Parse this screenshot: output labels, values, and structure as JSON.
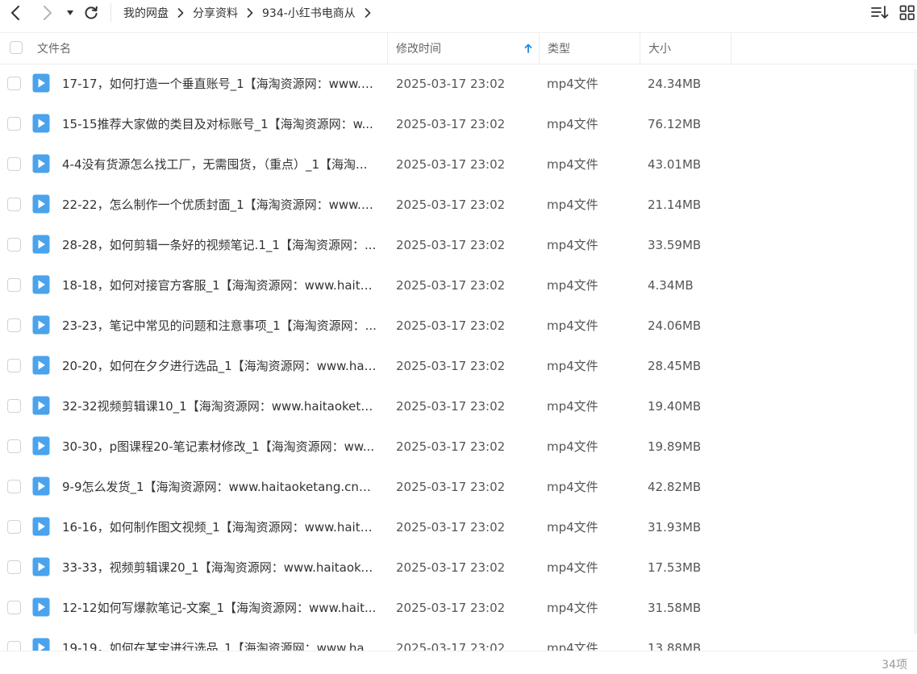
{
  "toolbar": {
    "back_icon": "chevron-left-icon",
    "forward_icon": "chevron-right-icon",
    "history_icon": "caret-down-icon",
    "refresh_icon": "refresh-icon",
    "sort_icon": "sort-list-icon",
    "view_icon": "grid-view-icon"
  },
  "breadcrumb": [
    "我的网盘",
    "分享资料",
    "934-小红书电商从"
  ],
  "columns": {
    "name": "文件名",
    "modified": "修改时间",
    "type": "类型",
    "size": "大小"
  },
  "sort": {
    "column": "modified",
    "direction": "ascending",
    "icon": "arrow-up-icon",
    "color": "#1e88e5"
  },
  "colors": {
    "video_icon": "#4aa3ec",
    "accent": "#1e88e5"
  },
  "files": [
    {
      "name": "17-17，如何打造一个垂直账号_1【海淘资源网：www.h...",
      "modified": "2025-03-17 23:02",
      "type": "mp4文件",
      "size": "24.34MB",
      "icon": "video-file-icon"
    },
    {
      "name": "15-15推荐大家做的类目及对标账号_1【海淘资源网：w...",
      "modified": "2025-03-17 23:02",
      "type": "mp4文件",
      "size": "76.12MB",
      "icon": "video-file-icon"
    },
    {
      "name": "4-4没有货源怎么找工厂，无需囤货，（重点）_1【海淘...",
      "modified": "2025-03-17 23:02",
      "type": "mp4文件",
      "size": "43.01MB",
      "icon": "video-file-icon"
    },
    {
      "name": "22-22，怎么制作一个优质封面_1【海淘资源网：www.h...",
      "modified": "2025-03-17 23:02",
      "type": "mp4文件",
      "size": "21.14MB",
      "icon": "video-file-icon"
    },
    {
      "name": "28-28，如何剪辑一条好的视频笔记.1_1【海淘资源网：...",
      "modified": "2025-03-17 23:02",
      "type": "mp4文件",
      "size": "33.59MB",
      "icon": "video-file-icon"
    },
    {
      "name": "18-18，如何对接官方客服_1【海淘资源网：www.haita...",
      "modified": "2025-03-17 23:02",
      "type": "mp4文件",
      "size": "4.34MB",
      "icon": "video-file-icon"
    },
    {
      "name": "23-23，笔记中常见的问题和注意事项_1【海淘资源网：...",
      "modified": "2025-03-17 23:02",
      "type": "mp4文件",
      "size": "24.06MB",
      "icon": "video-file-icon"
    },
    {
      "name": "20-20，如何在夕夕进行选品_1【海淘资源网：www.hai...",
      "modified": "2025-03-17 23:02",
      "type": "mp4文件",
      "size": "28.45MB",
      "icon": "video-file-icon"
    },
    {
      "name": "32-32视频剪辑课10_1【海淘资源网：www.haitaoketa...",
      "modified": "2025-03-17 23:02",
      "type": "mp4文件",
      "size": "19.40MB",
      "icon": "video-file-icon"
    },
    {
      "name": "30-30，p图课程20-笔记素材修改_1【海淘资源网：ww...",
      "modified": "2025-03-17 23:02",
      "type": "mp4文件",
      "size": "19.89MB",
      "icon": "video-file-icon"
    },
    {
      "name": "9-9怎么发货_1【海淘资源网：www.haitaoketang.cn】...",
      "modified": "2025-03-17 23:02",
      "type": "mp4文件",
      "size": "42.82MB",
      "icon": "video-file-icon"
    },
    {
      "name": "16-16，如何制作图文视频_1【海淘资源网：www.haita...",
      "modified": "2025-03-17 23:02",
      "type": "mp4文件",
      "size": "31.93MB",
      "icon": "video-file-icon"
    },
    {
      "name": "33-33，视频剪辑课20_1【海淘资源网：www.haitaoke...",
      "modified": "2025-03-17 23:02",
      "type": "mp4文件",
      "size": "17.53MB",
      "icon": "video-file-icon"
    },
    {
      "name": "12-12如何写爆款笔记-文案_1【海淘资源网：www.hait...",
      "modified": "2025-03-17 23:02",
      "type": "mp4文件",
      "size": "31.58MB",
      "icon": "video-file-icon"
    },
    {
      "name": "19-19，如何在某宝进行选品_1【海淘资源网：www.hai...",
      "modified": "2025-03-17 23:02",
      "type": "mp4文件",
      "size": "13.88MB",
      "icon": "video-file-icon"
    }
  ],
  "status": {
    "item_count": "34项"
  }
}
